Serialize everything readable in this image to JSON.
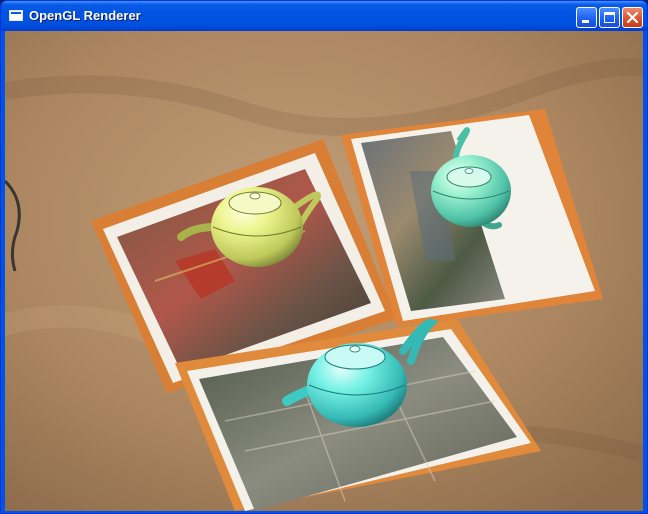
{
  "window": {
    "title": "OpenGL Renderer",
    "controls": {
      "minimize": "minimize-icon",
      "maximize": "maximize-icon",
      "close": "close-icon"
    }
  },
  "colors": {
    "titlebar": "#0054e3",
    "close_button": "#d8512b",
    "carpet": "#b08a63",
    "folder": "#e08a3c",
    "teapot_yellow": "#e8f08a",
    "teapot_cyan": "#6ff0e4",
    "teapot_mint": "#8ff0c8"
  }
}
